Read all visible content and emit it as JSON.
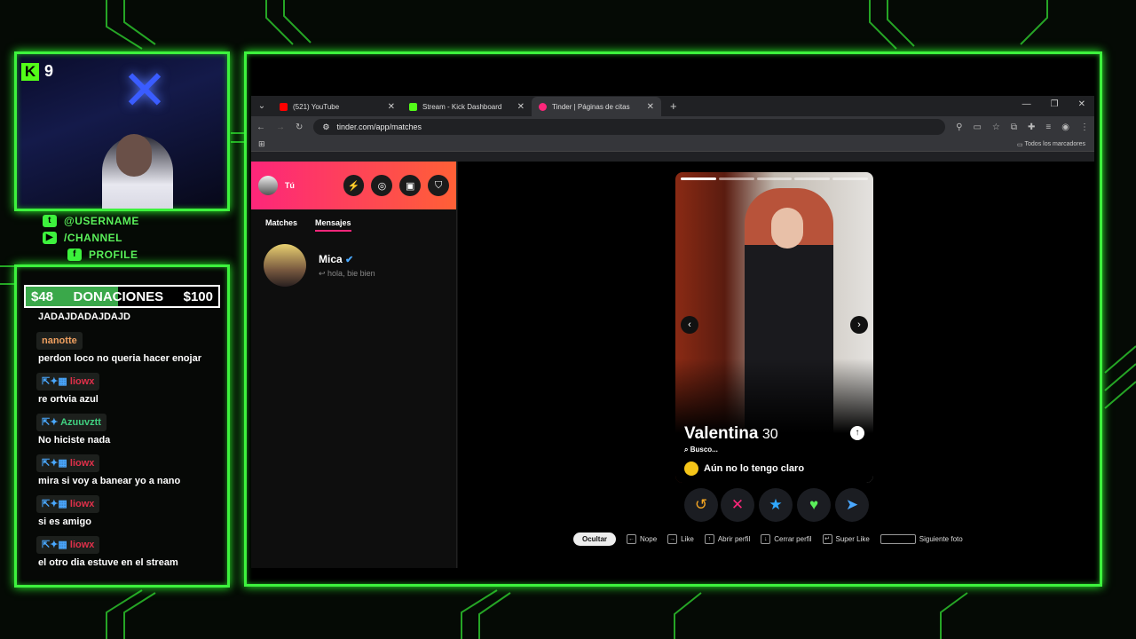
{
  "overlay": {
    "kick_logo": "K",
    "viewer_count": "9",
    "socials": [
      {
        "icon": "twitter-icon",
        "label": "@USERNAME"
      },
      {
        "icon": "youtube-icon",
        "label": "/CHANNEL"
      },
      {
        "icon": "facebook-icon",
        "label": "PROFILE"
      }
    ],
    "donation": {
      "current": "$48",
      "label": "DONACIONES",
      "goal": "$100",
      "progress": 0.48
    },
    "chat": [
      {
        "user": "",
        "message": "JADAJDADAJDAJD",
        "user_color": "#ffffff"
      },
      {
        "user": "nanotte",
        "message": "perdon loco no queria hacer enojar",
        "user_color": "#f0a060"
      },
      {
        "user": "liowx",
        "message": "re ortvia azul",
        "user_color": "#e0304a"
      },
      {
        "user": "Azuuvztt",
        "message": "No hiciste nada",
        "user_color": "#40d080"
      },
      {
        "user": "liowx",
        "message": "mira si voy a banear yo a nano",
        "user_color": "#e0304a"
      },
      {
        "user": "liowx",
        "message": "si es amigo",
        "user_color": "#e0304a"
      },
      {
        "user": "liowx",
        "message": "el otro dia estuve en el stream",
        "user_color": "#e0304a"
      }
    ]
  },
  "browser": {
    "tabs": [
      {
        "title": "(521) YouTube",
        "favicon_color": "#ff0000",
        "active": false
      },
      {
        "title": "Stream - Kick Dashboard",
        "favicon_color": "#53fc18",
        "active": false
      },
      {
        "title": "Tinder | Páginas de citas",
        "favicon_color": "#fd267a",
        "active": true
      }
    ],
    "new_tab": "+",
    "url": "tinder.com/app/matches",
    "bookmarks": "Todos los marcadores"
  },
  "tinder": {
    "user_label": "Tú",
    "tabs": {
      "matches": "Matches",
      "messages": "Mensajes"
    },
    "conversation": {
      "name": "Mica",
      "preview": "hola, bie bien"
    },
    "profile": {
      "name": "Valentina",
      "age": "30",
      "looking_label": "Busco...",
      "looking_value": "Aún no lo tengo claro"
    },
    "hints": [
      {
        "key": "Ocultar",
        "label": ""
      },
      {
        "key": "←",
        "label": "Nope"
      },
      {
        "key": "→",
        "label": "Like"
      },
      {
        "key": "↑",
        "label": "Abrir perfil"
      },
      {
        "key": "↓",
        "label": "Cerrar perfil"
      },
      {
        "key": "↵",
        "label": "Super Like"
      },
      {
        "key": "",
        "label": "Siguiente foto"
      }
    ]
  }
}
